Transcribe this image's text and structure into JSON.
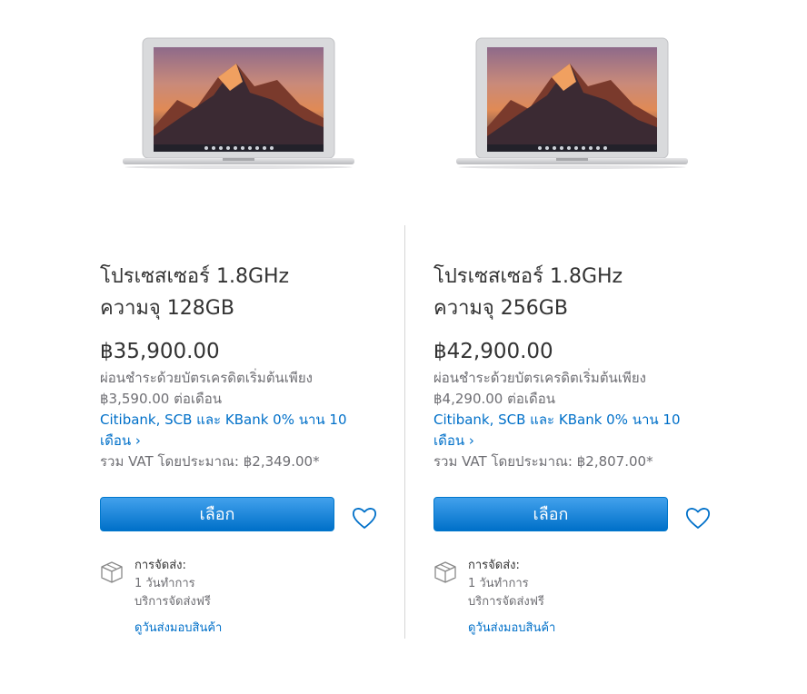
{
  "products": [
    {
      "title_line1": "โปรเซสเซอร์ 1.8GHz",
      "title_line2": "ความจุ 128GB",
      "price": "฿35,900.00",
      "installment_line1": "ผ่อนชำระด้วยบัตรเครดิตเริ่มต้นเพียง",
      "installment_line2": "฿3,590.00 ต่อเดือน",
      "bank_link_line1": "Citibank, SCB และ KBank 0% นาน 10",
      "bank_link_line2": "เดือน ›",
      "vat": "รวม VAT โดยประมาณ: ฿2,349.00*",
      "select_label": "เลือก",
      "shipping_title": "การจัดส่ง:",
      "shipping_time": "1 วันทำการ",
      "shipping_free": "บริการจัดส่งฟรี",
      "delivery_link": "ดูวันส่งมอบสินค้า"
    },
    {
      "title_line1": "โปรเซสเซอร์ 1.8GHz",
      "title_line2": "ความจุ 256GB",
      "price": "฿42,900.00",
      "installment_line1": "ผ่อนชำระด้วยบัตรเครดิตเริ่มต้นเพียง",
      "installment_line2": "฿4,290.00 ต่อเดือน",
      "bank_link_line1": "Citibank, SCB และ KBank 0% นาน 10",
      "bank_link_line2": "เดือน ›",
      "vat": "รวม VAT โดยประมาณ: ฿2,807.00*",
      "select_label": "เลือก",
      "shipping_title": "การจัดส่ง:",
      "shipping_time": "1 วันทำการ",
      "shipping_free": "บริการจัดส่งฟรี",
      "delivery_link": "ดูวันส่งมอบสินค้า"
    }
  ],
  "icons": {
    "favorite": "heart-icon",
    "shipping": "box-icon"
  },
  "colors": {
    "accent": "#0070c9",
    "button_top": "#42a1ec",
    "button_bottom": "#0070c9",
    "text": "#333333",
    "muted": "#6e6e73"
  }
}
